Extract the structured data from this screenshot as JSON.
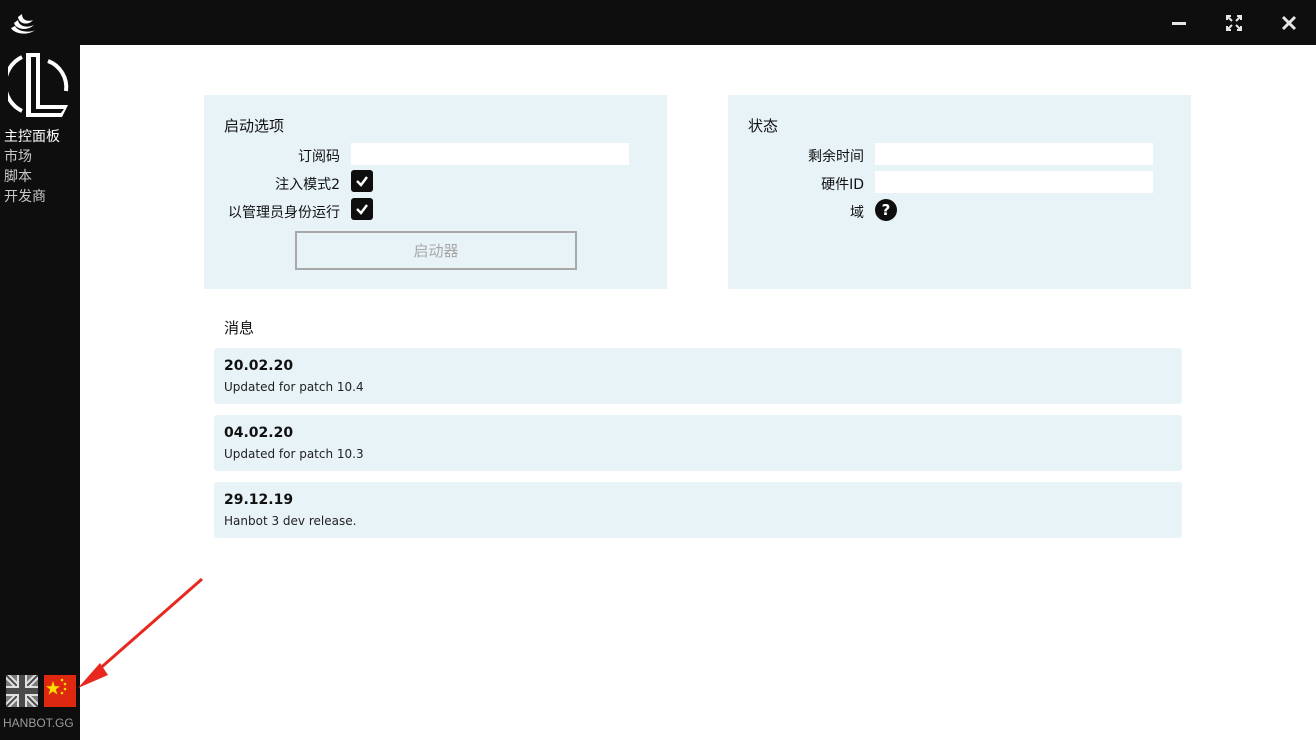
{
  "window": {
    "app_icon": "swirl-logo-icon",
    "controls": [
      "minimize-icon",
      "maximize-icon",
      "close-icon"
    ]
  },
  "sidebar": {
    "items": [
      {
        "label": "主控面板",
        "active": true
      },
      {
        "label": "市场",
        "active": false
      },
      {
        "label": "脚本",
        "active": false
      },
      {
        "label": "开发商",
        "active": false
      }
    ],
    "languages": [
      "uk-flag-icon",
      "china-flag-icon"
    ],
    "footer": "HANBOT.GG"
  },
  "launch_options": {
    "title": "启动选项",
    "subscription_label": "订阅码",
    "subscription_value": "",
    "inject_mode_label": "注入模式2",
    "inject_mode_checked": true,
    "run_as_admin_label": "以管理员身份运行",
    "run_as_admin_checked": true,
    "launch_button": "启动器"
  },
  "status": {
    "title": "状态",
    "remaining_time_label": "剩余时间",
    "remaining_time_value": "",
    "hwid_label": "硬件ID",
    "hwid_value": "",
    "domain_label": "域",
    "domain_icon": "help-icon"
  },
  "news": {
    "title": "消息",
    "items": [
      {
        "date": "20.02.20",
        "text": "Updated for patch 10.4"
      },
      {
        "date": "04.02.20",
        "text": "Updated for patch 10.3"
      },
      {
        "date": "29.12.19",
        "text": "Hanbot 3 dev release."
      }
    ]
  },
  "colors": {
    "chrome": "#0e0e0e",
    "panel": "#e8f3f8",
    "annotation": "#e8281e"
  }
}
